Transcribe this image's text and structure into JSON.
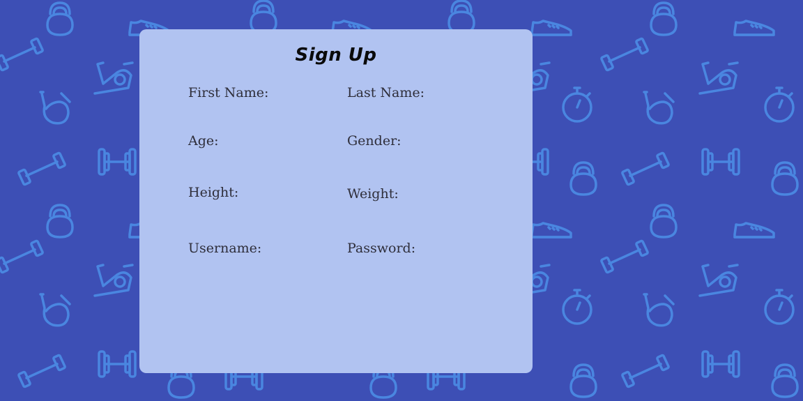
{
  "form": {
    "title": "Sign Up",
    "fields": {
      "first_name": "First Name:",
      "last_name": "Last Name:",
      "age": "Age:",
      "gender": "Gender:",
      "height": "Height:",
      "weight": "Weight:",
      "username": "Username:",
      "password": "Password:"
    }
  },
  "colors": {
    "background": "#3d4fb5",
    "pattern": "#4a86e0",
    "card": "#b1c3f1",
    "title_text": "#0a0a0a",
    "label_text": "#2e2e3a"
  },
  "background_icons": [
    "kettlebell-icon",
    "sneaker-icon",
    "dumbbell-icon",
    "exercise-bike-icon",
    "jump-rope-icon",
    "stopwatch-icon",
    "barbell-icon"
  ]
}
